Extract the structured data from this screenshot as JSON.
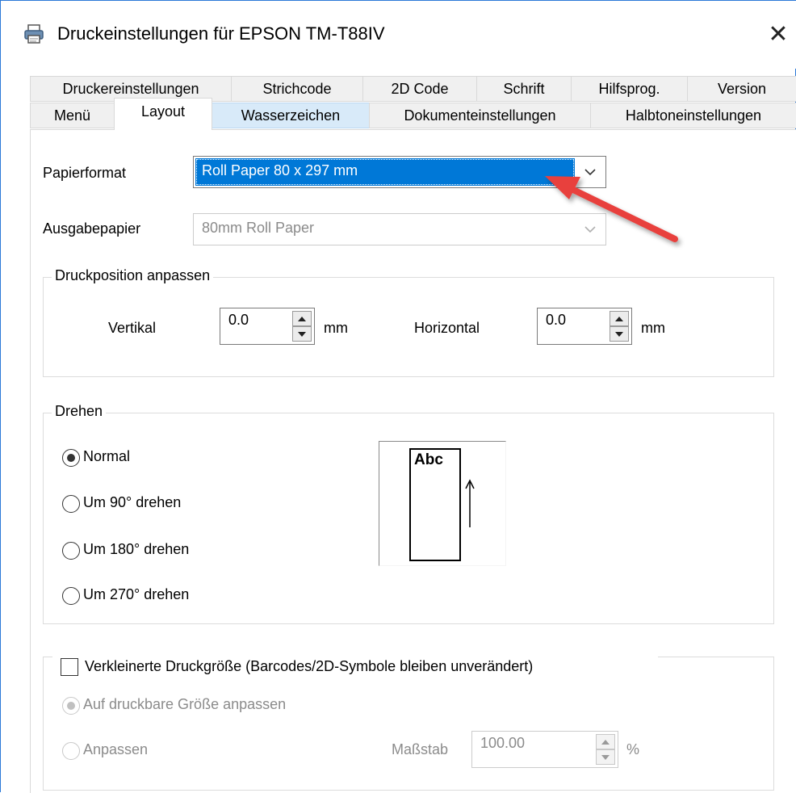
{
  "window": {
    "title": "Druckeinstellungen für EPSON TM-T88IV",
    "close_symbol": "✕"
  },
  "tabs": {
    "row1": [
      "Druckereinstellungen",
      "Strichcode",
      "2D Code",
      "Schrift",
      "Hilfsprog.",
      "Version"
    ],
    "row2": [
      "Menü",
      "Layout",
      "Wasserzeichen",
      "Dokumenteinstellungen",
      "Halbtoneinstellungen"
    ],
    "active": "Layout"
  },
  "layout": {
    "paper_format_label": "Papierformat",
    "paper_format_value": "Roll Paper 80 x 297 mm",
    "output_paper_label": "Ausgabepapier",
    "output_paper_value": "80mm Roll Paper",
    "position_group": {
      "title": "Druckposition anpassen",
      "vertical_label": "Vertikal",
      "vertical_value": "0.0",
      "horizontal_label": "Horizontal",
      "horizontal_value": "0.0",
      "unit": "mm"
    },
    "rotate_group": {
      "title": "Drehen",
      "options": [
        "Normal",
        "Um 90° drehen",
        "Um 180° drehen",
        "Um 270° drehen"
      ],
      "selected": "Normal",
      "preview_text": "Abc"
    },
    "reduce_group": {
      "checkbox_label": "Verkleinerte Druckgröße (Barcodes/2D-Symbole bleiben unverändert)",
      "checked": false,
      "fit_label": "Auf druckbare Größe anpassen",
      "adjust_label": "Anpassen",
      "scale_label": "Maßstab",
      "scale_value": "100.00",
      "scale_unit": "%"
    }
  },
  "colors": {
    "accent": "#0078d7",
    "annotation_arrow": "#e8413c",
    "tab_hover": "#d8eaf9"
  },
  "icons": {
    "title": "printer-icon",
    "combo": "chevron-down-icon",
    "spin_up": "triangle-up-icon",
    "spin_down": "triangle-down-icon",
    "annotation": "red-arrow-annotation"
  }
}
